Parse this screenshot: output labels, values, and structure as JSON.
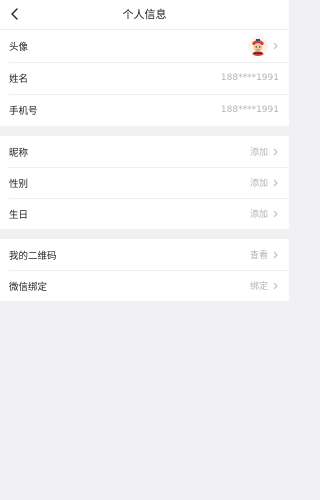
{
  "header": {
    "title": "个人信息"
  },
  "profile": {
    "avatar_label": "头像",
    "name_label": "姓名",
    "name_value": "188****1991",
    "phone_label": "手机号",
    "phone_value": "188****1991"
  },
  "details": {
    "nickname_label": "昵称",
    "nickname_action": "添加",
    "gender_label": "性别",
    "gender_action": "添加",
    "birthday_label": "生日",
    "birthday_action": "添加"
  },
  "extras": {
    "qrcode_label": "我的二维码",
    "qrcode_action": "查看",
    "wechat_label": "微信绑定",
    "wechat_action": "绑定"
  },
  "icons": {
    "back": "chevron-left-icon",
    "chevron": "chevron-right-icon",
    "avatar": "cartoon-avatar"
  }
}
